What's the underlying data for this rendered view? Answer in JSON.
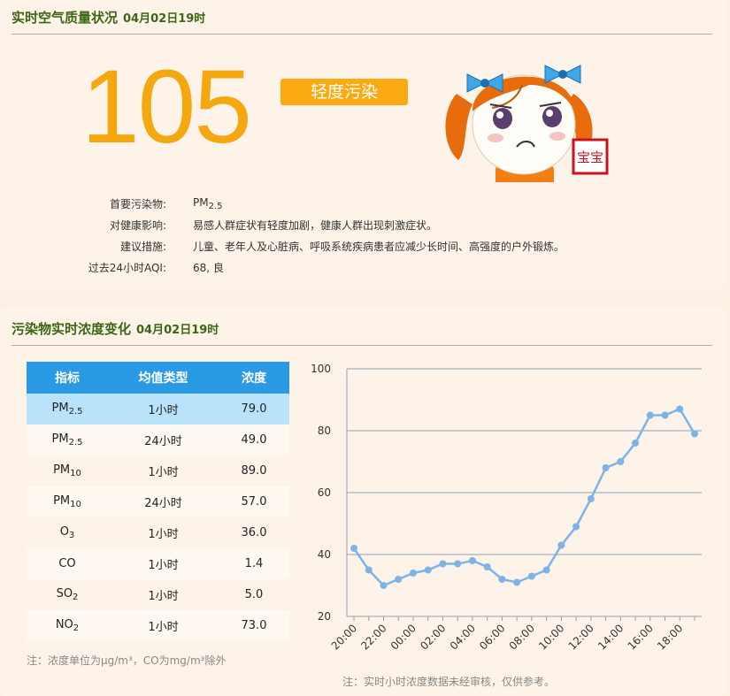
{
  "header": {
    "title": "实时空气质量状况",
    "datetime": "04月02日19时"
  },
  "aqi": {
    "value": "105",
    "level": "轻度污染",
    "level_color": "#fbaa12",
    "number_color": "#f4a70e"
  },
  "info": [
    {
      "label": "首要污染物:",
      "value_main": "PM",
      "value_sub": "2.5"
    },
    {
      "label": "对健康影响:",
      "value_main": "易感人群症状有轻度加剧，健康人群出现刺激症状。",
      "value_sub": ""
    },
    {
      "label": "建议措施:",
      "value_main": "儿童、老年人及心脏病、呼吸系统疾病患者应减少长时间、高强度的户外锻炼。",
      "value_sub": ""
    },
    {
      "label": "过去24小时AQI:",
      "value_main": "68, 良",
      "value_sub": ""
    }
  ],
  "mascot": {
    "icon": "girl-mascot-frown-icon",
    "stamp_text": "宝宝"
  },
  "section2": {
    "title": "污染物实时浓度变化",
    "datetime": "04月02日19时"
  },
  "table": {
    "headers": [
      "指标",
      "均值类型",
      "浓度"
    ],
    "rows": [
      {
        "ind_main": "PM",
        "ind_sub": "2.5",
        "type": "1小时",
        "value": "79.0"
      },
      {
        "ind_main": "PM",
        "ind_sub": "2.5",
        "type": "24小时",
        "value": "49.0"
      },
      {
        "ind_main": "PM",
        "ind_sub": "10",
        "type": "1小时",
        "value": "89.0"
      },
      {
        "ind_main": "PM",
        "ind_sub": "10",
        "type": "24小时",
        "value": "57.0"
      },
      {
        "ind_main": "O",
        "ind_sub": "3",
        "type": "1小时",
        "value": "36.0"
      },
      {
        "ind_main": "CO",
        "ind_sub": "",
        "type": "1小时",
        "value": "1.4"
      },
      {
        "ind_main": "SO",
        "ind_sub": "2",
        "type": "1小时",
        "value": "5.0"
      },
      {
        "ind_main": "NO",
        "ind_sub": "2",
        "type": "1小时",
        "value": "73.0"
      }
    ]
  },
  "notes": {
    "unit_note": "注：浓度单位为μg/m³，CO为mg/m³除外",
    "chart_note": "注：实时小时浓度数据未经审核，仅供参考。"
  },
  "colors": {
    "title_green": "#3d6614",
    "table_header": "#2b9ae5",
    "highlight_row": "#b9e2fb",
    "line": "#7eb3e6"
  },
  "chart_data": {
    "type": "line",
    "x": [
      "20:00",
      "21:00",
      "22:00",
      "23:00",
      "00:00",
      "01:00",
      "02:00",
      "03:00",
      "04:00",
      "05:00",
      "06:00",
      "07:00",
      "08:00",
      "09:00",
      "10:00",
      "11:00",
      "12:00",
      "13:00",
      "14:00",
      "15:00",
      "16:00",
      "17:00",
      "18:00",
      "19:00"
    ],
    "tick_labels": [
      "20:00",
      "22:00",
      "00:00",
      "02:00",
      "04:00",
      "06:00",
      "08:00",
      "10:00",
      "12:00",
      "14:00",
      "16:00",
      "18:00"
    ],
    "values": [
      42,
      35,
      30,
      32,
      34,
      35,
      37,
      37,
      38,
      36,
      32,
      31,
      33,
      35,
      43,
      49,
      58,
      68,
      70,
      76,
      85,
      85,
      87,
      79
    ],
    "ylim": [
      20,
      100
    ],
    "yticks": [
      20,
      40,
      60,
      80,
      100
    ],
    "grid": true
  }
}
